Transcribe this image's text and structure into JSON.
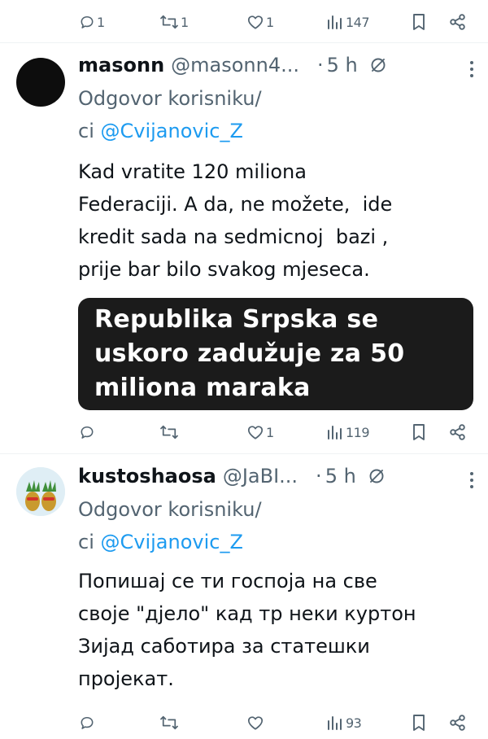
{
  "colors": {
    "accent": "#1d9bf0",
    "muted": "#536471",
    "text": "#0f1419",
    "banner_bg": "#1b1b1b"
  },
  "top_actions": {
    "reply": "1",
    "retweet": "1",
    "like": "1",
    "views": "147"
  },
  "tweets": [
    {
      "name": "masonn",
      "handle": "@masonn4...",
      "dot": "·",
      "time": "5 h",
      "reply_to_label": "Odgovor korisniku/",
      "reply_to_prefix": "ci ",
      "reply_to_mention": "@Cvijanovic_Z",
      "body_lines": [
        "Kad vratite 120 miliona",
        "Federaciji. A da, ne možete,  ide",
        "kredit sada na sedmicnoj  bazi ,",
        "prije bar bilo svakog mjeseca."
      ],
      "banner_lines": [
        "Republika Srpska se",
        "uskoro zadužuje za 50",
        "miliona maraka"
      ],
      "actions": {
        "reply": "",
        "retweet": "",
        "like": "1",
        "views": "119"
      }
    },
    {
      "name": "kustoshaosa",
      "handle": "@JaBI...",
      "dot": "·",
      "time": "5 h",
      "reply_to_label": "Odgovor korisniku/",
      "reply_to_prefix": "ci ",
      "reply_to_mention": "@Cvijanovic_Z",
      "body_lines": [
        "Попишај се ти госпоја на све",
        "своје \"дјело\" кад тр неки куртон",
        "Зијад саботира за статешки",
        "пројекат."
      ],
      "actions": {
        "reply": "",
        "retweet": "",
        "like": "",
        "views": "93"
      }
    }
  ]
}
